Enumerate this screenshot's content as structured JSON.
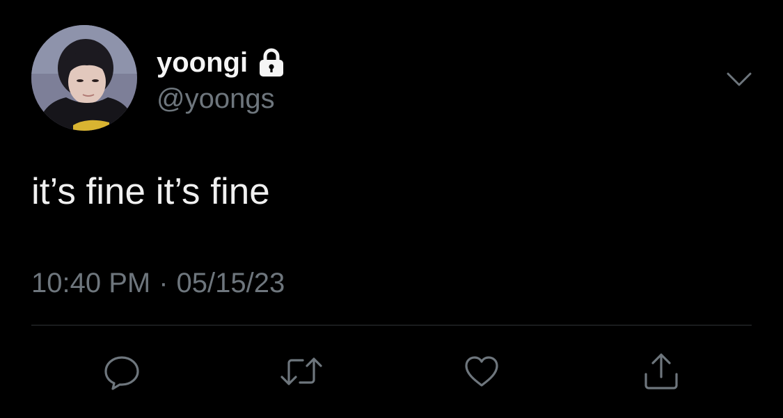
{
  "tweet": {
    "display_name": "yoongi",
    "handle": "@yoongs",
    "protected_icon": "lock-icon",
    "text": "it’s fine it’s fine",
    "time": "10:40 PM",
    "separator": "·",
    "date": "05/15/23"
  },
  "actions": [
    {
      "icon": "reply-icon"
    },
    {
      "icon": "retweet-icon"
    },
    {
      "icon": "like-icon"
    },
    {
      "icon": "share-icon"
    }
  ],
  "colors": {
    "background": "#000000",
    "primary_text": "#f0f0f0",
    "secondary_text": "#6e767d",
    "divider": "#2f3336"
  }
}
